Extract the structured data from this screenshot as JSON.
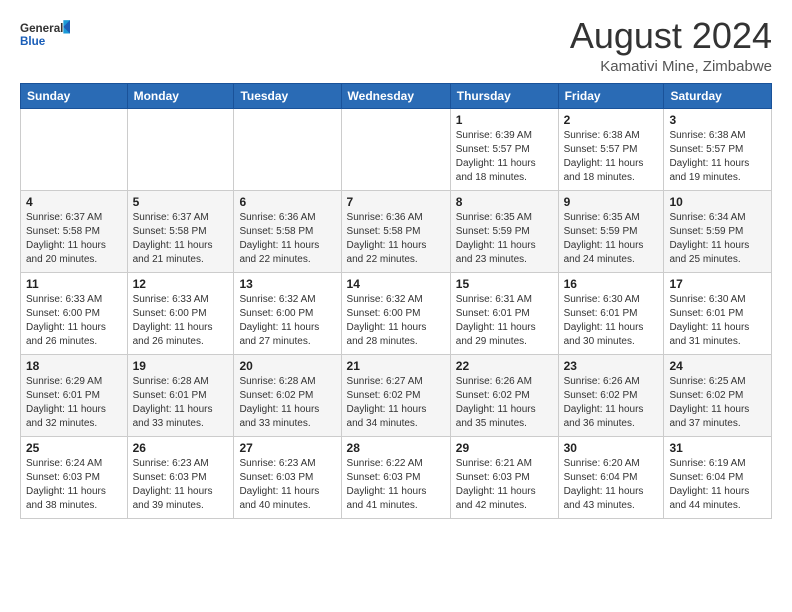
{
  "logo": {
    "line1": "General",
    "line2": "Blue"
  },
  "title": "August 2024",
  "subtitle": "Kamativi Mine, Zimbabwe",
  "days_of_week": [
    "Sunday",
    "Monday",
    "Tuesday",
    "Wednesday",
    "Thursday",
    "Friday",
    "Saturday"
  ],
  "weeks": [
    [
      {
        "day": "",
        "info": ""
      },
      {
        "day": "",
        "info": ""
      },
      {
        "day": "",
        "info": ""
      },
      {
        "day": "",
        "info": ""
      },
      {
        "day": "1",
        "info": "Sunrise: 6:39 AM\nSunset: 5:57 PM\nDaylight: 11 hours\nand 18 minutes."
      },
      {
        "day": "2",
        "info": "Sunrise: 6:38 AM\nSunset: 5:57 PM\nDaylight: 11 hours\nand 18 minutes."
      },
      {
        "day": "3",
        "info": "Sunrise: 6:38 AM\nSunset: 5:57 PM\nDaylight: 11 hours\nand 19 minutes."
      }
    ],
    [
      {
        "day": "4",
        "info": "Sunrise: 6:37 AM\nSunset: 5:58 PM\nDaylight: 11 hours\nand 20 minutes."
      },
      {
        "day": "5",
        "info": "Sunrise: 6:37 AM\nSunset: 5:58 PM\nDaylight: 11 hours\nand 21 minutes."
      },
      {
        "day": "6",
        "info": "Sunrise: 6:36 AM\nSunset: 5:58 PM\nDaylight: 11 hours\nand 22 minutes."
      },
      {
        "day": "7",
        "info": "Sunrise: 6:36 AM\nSunset: 5:58 PM\nDaylight: 11 hours\nand 22 minutes."
      },
      {
        "day": "8",
        "info": "Sunrise: 6:35 AM\nSunset: 5:59 PM\nDaylight: 11 hours\nand 23 minutes."
      },
      {
        "day": "9",
        "info": "Sunrise: 6:35 AM\nSunset: 5:59 PM\nDaylight: 11 hours\nand 24 minutes."
      },
      {
        "day": "10",
        "info": "Sunrise: 6:34 AM\nSunset: 5:59 PM\nDaylight: 11 hours\nand 25 minutes."
      }
    ],
    [
      {
        "day": "11",
        "info": "Sunrise: 6:33 AM\nSunset: 6:00 PM\nDaylight: 11 hours\nand 26 minutes."
      },
      {
        "day": "12",
        "info": "Sunrise: 6:33 AM\nSunset: 6:00 PM\nDaylight: 11 hours\nand 26 minutes."
      },
      {
        "day": "13",
        "info": "Sunrise: 6:32 AM\nSunset: 6:00 PM\nDaylight: 11 hours\nand 27 minutes."
      },
      {
        "day": "14",
        "info": "Sunrise: 6:32 AM\nSunset: 6:00 PM\nDaylight: 11 hours\nand 28 minutes."
      },
      {
        "day": "15",
        "info": "Sunrise: 6:31 AM\nSunset: 6:01 PM\nDaylight: 11 hours\nand 29 minutes."
      },
      {
        "day": "16",
        "info": "Sunrise: 6:30 AM\nSunset: 6:01 PM\nDaylight: 11 hours\nand 30 minutes."
      },
      {
        "day": "17",
        "info": "Sunrise: 6:30 AM\nSunset: 6:01 PM\nDaylight: 11 hours\nand 31 minutes."
      }
    ],
    [
      {
        "day": "18",
        "info": "Sunrise: 6:29 AM\nSunset: 6:01 PM\nDaylight: 11 hours\nand 32 minutes."
      },
      {
        "day": "19",
        "info": "Sunrise: 6:28 AM\nSunset: 6:01 PM\nDaylight: 11 hours\nand 33 minutes."
      },
      {
        "day": "20",
        "info": "Sunrise: 6:28 AM\nSunset: 6:02 PM\nDaylight: 11 hours\nand 33 minutes."
      },
      {
        "day": "21",
        "info": "Sunrise: 6:27 AM\nSunset: 6:02 PM\nDaylight: 11 hours\nand 34 minutes."
      },
      {
        "day": "22",
        "info": "Sunrise: 6:26 AM\nSunset: 6:02 PM\nDaylight: 11 hours\nand 35 minutes."
      },
      {
        "day": "23",
        "info": "Sunrise: 6:26 AM\nSunset: 6:02 PM\nDaylight: 11 hours\nand 36 minutes."
      },
      {
        "day": "24",
        "info": "Sunrise: 6:25 AM\nSunset: 6:02 PM\nDaylight: 11 hours\nand 37 minutes."
      }
    ],
    [
      {
        "day": "25",
        "info": "Sunrise: 6:24 AM\nSunset: 6:03 PM\nDaylight: 11 hours\nand 38 minutes."
      },
      {
        "day": "26",
        "info": "Sunrise: 6:23 AM\nSunset: 6:03 PM\nDaylight: 11 hours\nand 39 minutes."
      },
      {
        "day": "27",
        "info": "Sunrise: 6:23 AM\nSunset: 6:03 PM\nDaylight: 11 hours\nand 40 minutes."
      },
      {
        "day": "28",
        "info": "Sunrise: 6:22 AM\nSunset: 6:03 PM\nDaylight: 11 hours\nand 41 minutes."
      },
      {
        "day": "29",
        "info": "Sunrise: 6:21 AM\nSunset: 6:03 PM\nDaylight: 11 hours\nand 42 minutes."
      },
      {
        "day": "30",
        "info": "Sunrise: 6:20 AM\nSunset: 6:04 PM\nDaylight: 11 hours\nand 43 minutes."
      },
      {
        "day": "31",
        "info": "Sunrise: 6:19 AM\nSunset: 6:04 PM\nDaylight: 11 hours\nand 44 minutes."
      }
    ]
  ]
}
